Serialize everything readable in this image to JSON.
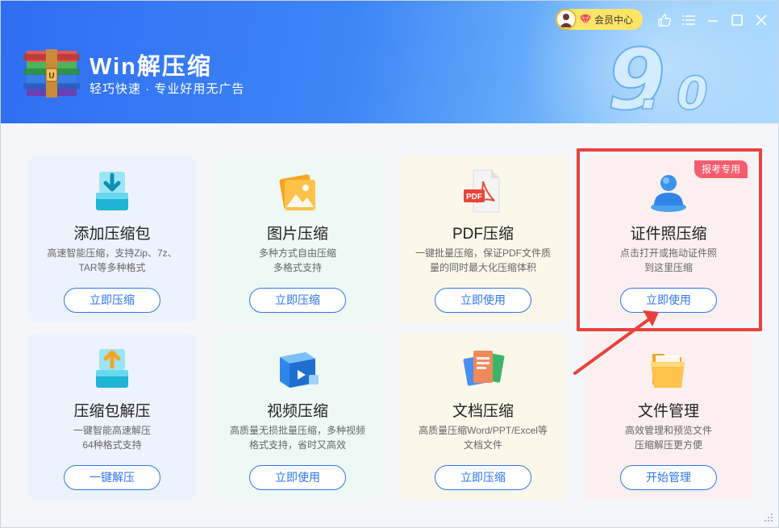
{
  "header": {
    "app_title": "Win解压缩",
    "app_subtitle": "轻巧快速 · 专业好用无广告",
    "version_major": "9",
    "version_minor": "0",
    "member_label": "会员中心"
  },
  "colors": {
    "accent": "#2f75ee",
    "badge": "#f45d6e",
    "highlight": "#e8413d",
    "header_start": "#2f6df2",
    "header_end": "#a9daff"
  },
  "window_controls": [
    "like-icon",
    "menu-icon",
    "minimize-icon",
    "maximize-icon",
    "close-icon"
  ],
  "cards": [
    {
      "title": "添加压缩包",
      "desc_line1": "高速智能压缩，支持Zip、7z、",
      "desc_line2": "TAR等多种格式",
      "button": "立即压缩",
      "icon": "add-archive-icon"
    },
    {
      "title": "图片压缩",
      "desc_line1": "多种方式自由压缩",
      "desc_line2": "多格式支持",
      "button": "立即压缩",
      "icon": "image-icon"
    },
    {
      "title": "PDF压缩",
      "desc_line1": "一键批量压缩，保证PDF文件质",
      "desc_line2": "量的同时最大化压缩体积",
      "button": "立即使用",
      "icon": "pdf-icon"
    },
    {
      "title": "证件照压缩",
      "desc_line1": "点击打开或拖动证件照",
      "desc_line2": "到这里压缩",
      "button": "立即使用",
      "icon": "id-photo-icon",
      "badge": "报考专用"
    },
    {
      "title": "压缩包解压",
      "desc_line1": "一键智能高速解压",
      "desc_line2": "64种格式支持",
      "button": "一键解压",
      "icon": "extract-icon"
    },
    {
      "title": "视频压缩",
      "desc_line1": "高质量无损批量压缩，多种视频",
      "desc_line2": "格式支持，省时又高效",
      "button": "立即使用",
      "icon": "video-icon"
    },
    {
      "title": "文档压缩",
      "desc_line1": "高质量压缩Word/PPT/Excel等",
      "desc_line2": "文档文件",
      "button": "立即压缩",
      "icon": "document-icon"
    },
    {
      "title": "文件管理",
      "desc_line1": "高效管理和预览文件",
      "desc_line2": "压缩解压更方便",
      "button": "开始管理",
      "icon": "folder-icon"
    }
  ]
}
